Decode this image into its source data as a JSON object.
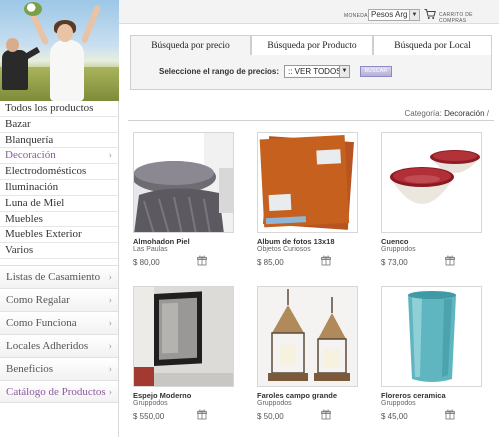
{
  "sidebar": {
    "categories": [
      {
        "label": "Todos los productos",
        "active": false
      },
      {
        "label": "Bazar",
        "active": false
      },
      {
        "label": "Blanquería",
        "active": false
      },
      {
        "label": "Decoración",
        "active": true,
        "chevron": "›"
      },
      {
        "label": "Electrodomésticos",
        "active": false
      },
      {
        "label": "Iluminación",
        "active": false
      },
      {
        "label": "Luna de Miel",
        "active": false
      },
      {
        "label": "Muebles",
        "active": false
      },
      {
        "label": "Muebles Exterior",
        "active": false
      },
      {
        "label": "Varios",
        "active": false
      }
    ],
    "menu": [
      {
        "label": "Listas de Casamiento",
        "chevron": "›"
      },
      {
        "label": "Como Regalar",
        "chevron": "›"
      },
      {
        "label": "Como Funciona",
        "chevron": "›"
      },
      {
        "label": "Locales Adheridos",
        "chevron": "›"
      },
      {
        "label": "Beneficios",
        "chevron": "›"
      },
      {
        "label": "Catálogo de Productos",
        "chevron": "›"
      }
    ]
  },
  "topbar": {
    "currency_label": "MONEDA",
    "currency_value": "Pesos Arg",
    "cart_label": "CARRITO DE COMPRAS",
    "cart_icon": "shopping-cart-icon"
  },
  "search": {
    "tabs": [
      {
        "label": "Búsqueda por precio",
        "active": true
      },
      {
        "label": "Búsqueda por Producto",
        "active": false
      },
      {
        "label": "Búsqueda por Local",
        "active": false
      }
    ],
    "range_label": "Seleccione el rango de precios:",
    "range_value": ":: VER TODOS",
    "button_label": "BUSCAR"
  },
  "breadcrumb": {
    "prefix": "Categoría:",
    "current": "Decoración",
    "separator": "/"
  },
  "products": [
    {
      "name": "Almohadon Piel",
      "vendor": "Las Paulas",
      "price": "$ 80,00",
      "icon": "gift-box-icon"
    },
    {
      "name": "Album de fotos 13x18",
      "vendor": "Objetos Curiosos",
      "price": "$ 85,00",
      "icon": "gift-box-icon"
    },
    {
      "name": "Cuenco",
      "vendor": "Gruppodos",
      "price": "$ 73,00",
      "icon": "gift-box-icon"
    },
    {
      "name": "Espejo Moderno",
      "vendor": "Gruppodos",
      "price": "$ 550,00",
      "icon": "gift-box-icon"
    },
    {
      "name": "Faroles campo grande",
      "vendor": "Gruppodos",
      "price": "$ 50,00",
      "icon": "gift-box-icon"
    },
    {
      "name": "Floreros ceramica",
      "vendor": "Gruppodos",
      "price": "$ 45,00",
      "icon": "gift-box-icon"
    }
  ],
  "colors": {
    "accent_purple": "#8a5a9e",
    "button_purple": "#b4afd9",
    "border": "#cfcfcf"
  }
}
